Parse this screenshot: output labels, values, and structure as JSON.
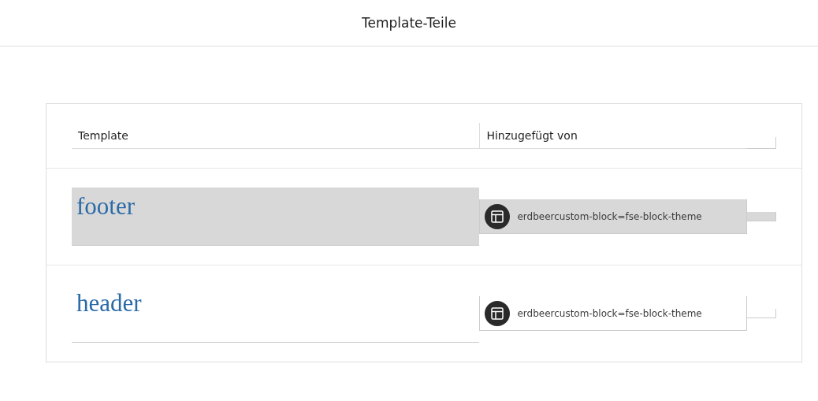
{
  "page_title": "Template-Teile",
  "table": {
    "columns": [
      "Template",
      "Hinzugefügt von"
    ],
    "rows": [
      {
        "template": "footer",
        "added_by": "erdbeercustom-block=fse-block-theme",
        "selected": true
      },
      {
        "template": "header",
        "added_by": "erdbeercustom-block=fse-block-theme",
        "selected": false
      }
    ]
  }
}
